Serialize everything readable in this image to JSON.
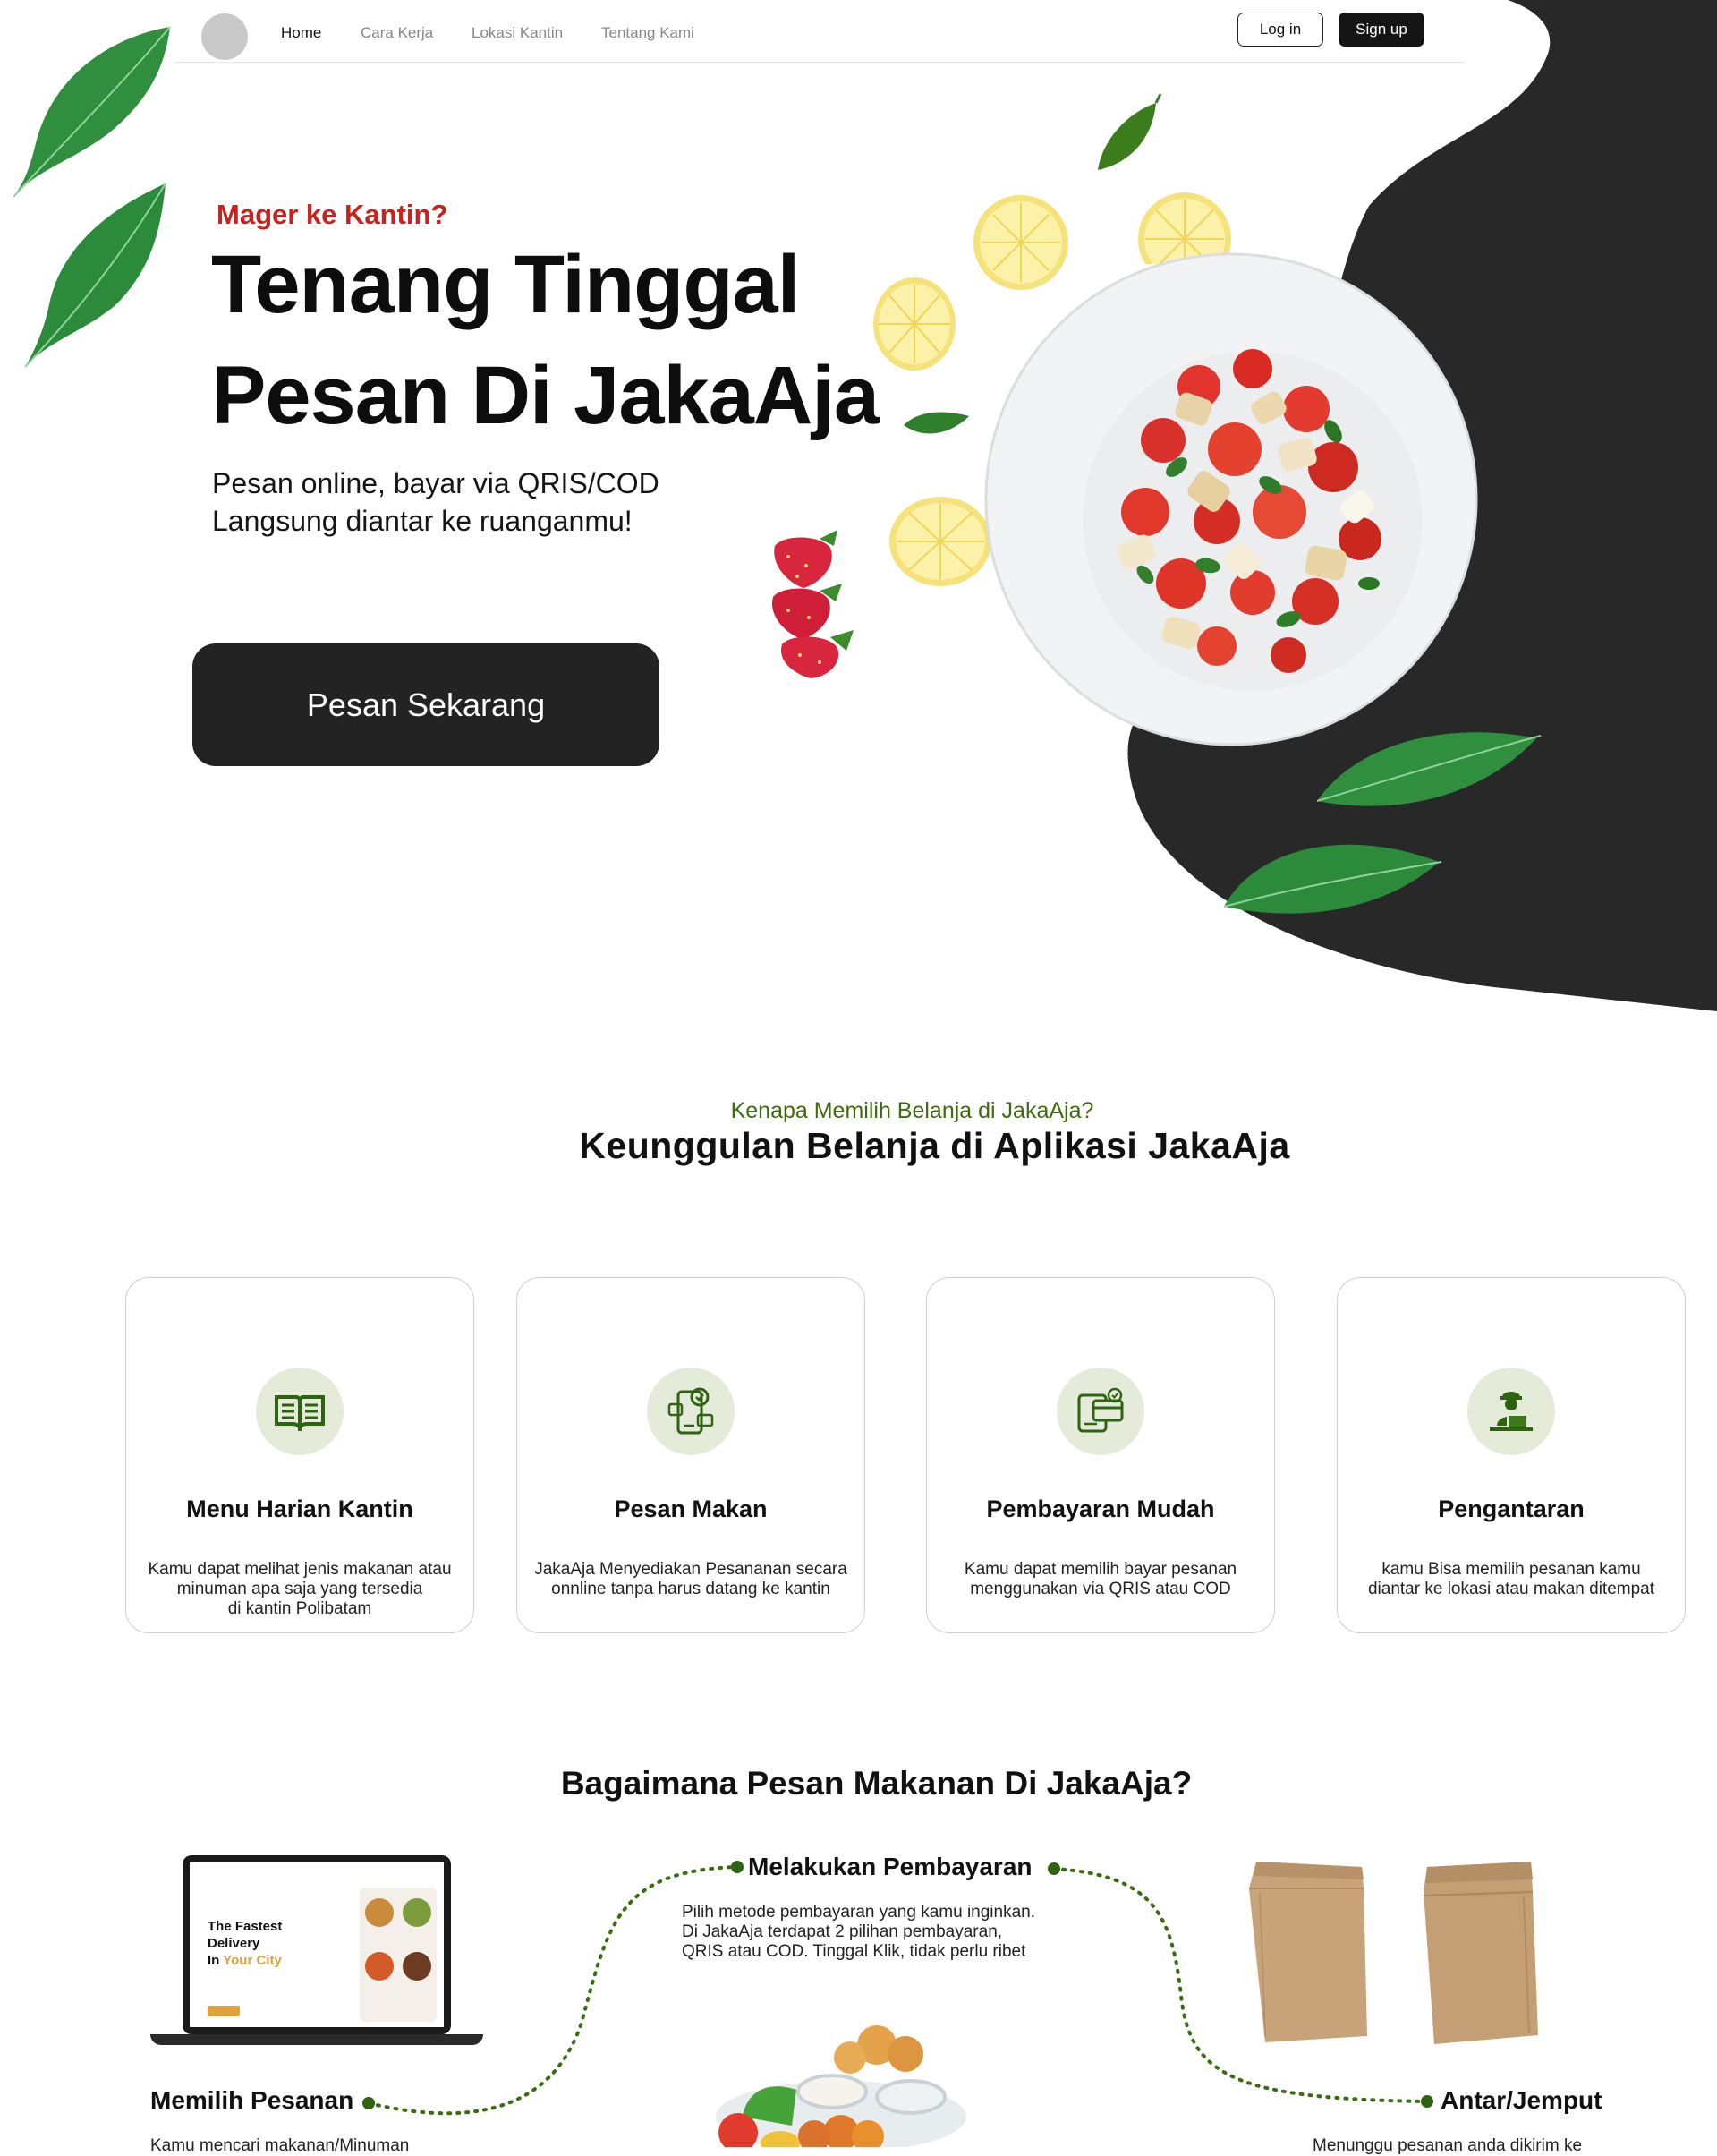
{
  "nav": {
    "links": [
      "Home",
      "Cara Kerja",
      "Lokasi Kantin",
      "Tentang Kami"
    ],
    "login": "Log in",
    "signup": "Sign up"
  },
  "hero": {
    "eyebrow": "Mager ke Kantin?",
    "title_line1": "Tenang Tinggal",
    "title_line2": "Pesan Di JakaAja",
    "sub_line1": "Pesan online, bayar via QRIS/COD",
    "sub_line2": "Langsung diantar ke ruanganmu!",
    "cta": "Pesan Sekarang"
  },
  "features": {
    "eyebrow": "Kenapa Memilih Belanja di JakaAja?",
    "title": "Keunggulan Belanja di Aplikasi JakaAja",
    "cards": [
      {
        "title": "Menu Harian Kantin",
        "text": [
          "Kamu dapat melihat jenis makanan atau",
          "minuman apa saja yang tersedia",
          "di kantin Polibatam"
        ],
        "icon": "book-menu-icon"
      },
      {
        "title": "Pesan Makan",
        "text": [
          "JakaAja Menyediakan Pesananan secara",
          "onnline tanpa harus datang ke kantin"
        ],
        "icon": "phone-order-icon"
      },
      {
        "title": "Pembayaran Mudah",
        "text": [
          "Kamu dapat memilih bayar pesanan",
          "menggunakan via QRIS atau COD"
        ],
        "icon": "payment-card-icon"
      },
      {
        "title": "Pengantaran",
        "text": [
          "kamu Bisa memilih pesanan kamu",
          "diantar ke lokasi atau makan ditempat"
        ],
        "icon": "delivery-courier-icon"
      }
    ]
  },
  "how": {
    "title": "Bagaimana Pesan Makanan Di JakaAja?",
    "steps": {
      "choose": {
        "label": "Memilih Pesanan",
        "text": "Kamu mencari makanan/Minuman"
      },
      "pay": {
        "label": "Melakukan Pembayaran",
        "text": [
          "Pilih metode pembayaran yang kamu inginkan.",
          "Di JakaAja terdapat 2 pilihan pembayaran,",
          "QRIS atau COD. Tinggal Klik, tidak perlu ribet"
        ]
      },
      "deliver": {
        "label": "Antar/Jemput",
        "text": "Menunggu pesanan anda dikirim ke"
      }
    },
    "laptop_screen": {
      "headline1": "The Fastest",
      "headline2": "Delivery",
      "headline3a": "In ",
      "headline3b": "Your City"
    }
  },
  "colors": {
    "accent_red": "#c8221f",
    "accent_green": "#3f6a0e",
    "dark": "#232323",
    "icon_bg": "#e4ecd9"
  }
}
